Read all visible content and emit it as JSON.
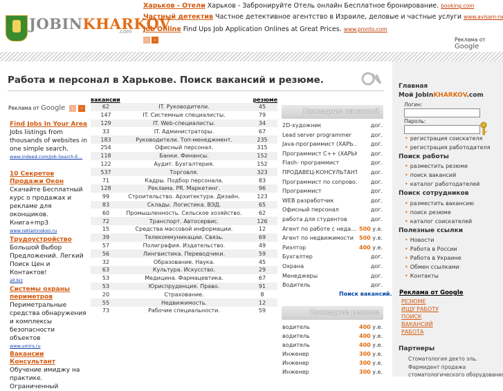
{
  "header": {
    "logo_part1": "JOBIN",
    "logo_part2": "KHARKOV",
    "logo_sub": ".com",
    "ads": [
      {
        "title": "Харьков - Отели",
        "text": " Харьков - Забронируйте Отель онлайн Бесплатное бронирование. ",
        "url": "booking.com"
      },
      {
        "title": "Частный детектив",
        "text": " Частное детективное агентство в Израиле, деловые и частные услуги ",
        "url": "www.avisam-netz.co.il"
      },
      {
        "title": "Job Online",
        "text": " Find Ups Job Application Onlines at Great Prices. ",
        "url": "www.pronto.com"
      }
    ],
    "ads_by": "Реклама от",
    "google": "Google",
    "prev": "‹",
    "next": "›"
  },
  "page_title": "Работа и персонал в Харькове. Поиск вакансий и резюме.",
  "left_ads": {
    "ads_by": "Реклама от",
    "google": "Google",
    "items": [
      {
        "title": "Find Jobs In Your Area",
        "text": "Jobs listings from thousands of websites in one simple search.",
        "url": "www.indeed.com/Job-Search-E..."
      },
      {
        "title": "10 Секретов Продажи Окон",
        "text": "Скачайте Бесплатный курс о продажах и рекламе для оконщиков. Книга+mp3",
        "url": "www.reklamnokon.ru"
      },
      {
        "title": "Трудоустройство",
        "text": "Большой Выбор Предложений. Легкий Поиск Цен и Контактов!",
        "url": "all.biz"
      },
      {
        "title": "Системы охраны периметров",
        "text": "Периметральные средства обнаружения и комплексы безопасности объектов",
        "url": "www.umirs.ru"
      },
      {
        "title": "Вакансии Консультант",
        "text": "Обучение имиджу на практике. Ограниченный",
        "url": ""
      }
    ]
  },
  "table": {
    "col_vac": "вакансии",
    "col_res": "резюме",
    "rows": [
      {
        "v": "62",
        "name": "IT. Руководители.",
        "r": "45"
      },
      {
        "v": "147",
        "name": "IT. Системные специалисты.",
        "r": "79"
      },
      {
        "v": "129",
        "name": "IT. Web-специалисты.",
        "r": "34"
      },
      {
        "v": "33",
        "name": "IT. Администраторы.",
        "r": "67"
      },
      {
        "v": "183",
        "name": "Руководители. Топ-менеджмент.",
        "r": "235"
      },
      {
        "v": "254",
        "name": "Офисный персонал.",
        "r": "315"
      },
      {
        "v": "118",
        "name": "Банки. Финансы.",
        "r": "152"
      },
      {
        "v": "122",
        "name": "Аудит. Бухгалтерия.",
        "r": "152"
      },
      {
        "v": "537",
        "name": "Торговля.",
        "r": "323"
      },
      {
        "v": "71",
        "name": "Кадры. Подбор персонала.",
        "r": "83"
      },
      {
        "v": "128",
        "name": "Реклама. PR. Маркетинг.",
        "r": "96"
      },
      {
        "v": "99",
        "name": "Строительство. Архитектура. Дизайн.",
        "r": "123"
      },
      {
        "v": "83",
        "name": "Склады. Логистика. ВЭД.",
        "r": "65"
      },
      {
        "v": "60",
        "name": "Промышленность. Сельское хозяйство.",
        "r": "62"
      },
      {
        "v": "72",
        "name": "Транспорт. Автосервис.",
        "r": "126"
      },
      {
        "v": "15",
        "name": "Средства массовой информации.",
        "r": "12"
      },
      {
        "v": "39",
        "name": "Телекоммуникации. Связь.",
        "r": "69"
      },
      {
        "v": "57",
        "name": "Полиграфия. Издательство.",
        "r": "49"
      },
      {
        "v": "56",
        "name": "Лингвистика. Переводчики.",
        "r": "59"
      },
      {
        "v": "32",
        "name": "Образование. Наука.",
        "r": "45"
      },
      {
        "v": "63",
        "name": "Культура. Искусство.",
        "r": "29"
      },
      {
        "v": "53",
        "name": "Медицина. Фармацевтика.",
        "r": "67"
      },
      {
        "v": "53",
        "name": "Юриспруденция. Право.",
        "r": "91"
      },
      {
        "v": "20",
        "name": "Страхование.",
        "r": "8"
      },
      {
        "v": "55",
        "name": "Недвижимость.",
        "r": "12"
      },
      {
        "v": "73",
        "name": "Рабочие специальности.",
        "r": "59"
      }
    ]
  },
  "vacancies": {
    "title": "Последние вакансий",
    "items": [
      {
        "name": "2D-художник",
        "sal": "",
        "unit": "дог."
      },
      {
        "name": "Lead server programmer",
        "sal": "",
        "unit": "дог."
      },
      {
        "name": "Java-программист (ХАРЬ...",
        "sal": "",
        "unit": "дог."
      },
      {
        "name": "Программист С++ (ХАРЬК...",
        "sal": "",
        "unit": "дог."
      },
      {
        "name": "Flash- программист",
        "sal": "",
        "unit": "дог."
      },
      {
        "name": "ПРОДАВЕЦ-КОНСУЛЬТАНТ в...",
        "sal": "",
        "unit": "дог."
      },
      {
        "name": "Программист по сопрово...",
        "sal": "",
        "unit": "дог."
      },
      {
        "name": "Программист",
        "sal": "",
        "unit": "дог."
      },
      {
        "name": "WEB разработчик",
        "sal": "",
        "unit": "дог."
      },
      {
        "name": "Офисный персонал",
        "sal": "",
        "unit": "дог."
      },
      {
        "name": "работа для студентов",
        "sal": "",
        "unit": "дог."
      },
      {
        "name": "Агент по работе с неда...",
        "sal": "500",
        "unit": " у.е."
      },
      {
        "name": "Агент по недвижимости",
        "sal": "500",
        "unit": " у.е."
      },
      {
        "name": "Риэлтор",
        "sal": "400",
        "unit": " у.е."
      },
      {
        "name": "Бухгалтер",
        "sal": "",
        "unit": "дог."
      },
      {
        "name": "Охрана",
        "sal": "",
        "unit": "дог."
      },
      {
        "name": "Менеджеры",
        "sal": "",
        "unit": "дог."
      },
      {
        "name": "Водитель",
        "sal": "",
        "unit": "дог."
      }
    ],
    "search_link": "Поиск вакансий."
  },
  "resumes": {
    "title": "Последние резюме",
    "items": [
      {
        "name": "водитель",
        "sal": "400",
        "unit": " у.е."
      },
      {
        "name": "водитель",
        "sal": "400",
        "unit": " у.е."
      },
      {
        "name": "водитель",
        "sal": "400",
        "unit": " у.е."
      },
      {
        "name": "Инженер",
        "sal": "300",
        "unit": " у.е."
      },
      {
        "name": "Инженер",
        "sal": "300",
        "unit": " у.е."
      },
      {
        "name": "Инженер",
        "sal": "300",
        "unit": " у.е."
      }
    ]
  },
  "sidebar": {
    "home": "Главная",
    "my_prefix": "Мой JobIn",
    "my_brand": "KHARKOV",
    "my_suffix": ".com",
    "login_label": "Логин:",
    "password_label": "Пароль:",
    "reg_seeker": "регистрация соискателя",
    "reg_employer": "регистрация работодателя",
    "job_search": "Поиск работы",
    "post_resume": "разместить резюме",
    "find_vacancies": "поиск вакансий",
    "employers_catalog": "каталог работодателей",
    "staff_search": "Поиск сотрудников",
    "post_vacancy": "разместить вакансию",
    "find_resume": "поиск резюме",
    "seekers_catalog": "каталог соискателей",
    "useful_links": "Полезные ссылки",
    "news": "Новости",
    "work_russia": "Работа в России",
    "work_ukraine": "Работа в Украине",
    "link_exchange": "Обмен ссылками",
    "contacts": "Контакты",
    "ads_by": "Реклама от Google",
    "ad_links": [
      "РЕЗЮМЕ",
      "ИЩУ РАБОТУ",
      "ПОИСК",
      "ВАКАНСИЙ",
      "РАБОТА"
    ],
    "partners": "Партнеры",
    "partner_1": "Стоматология декто эль.",
    "partner_2": "Фармидент продажа",
    "partner_3": "стоматологического оборудования"
  }
}
